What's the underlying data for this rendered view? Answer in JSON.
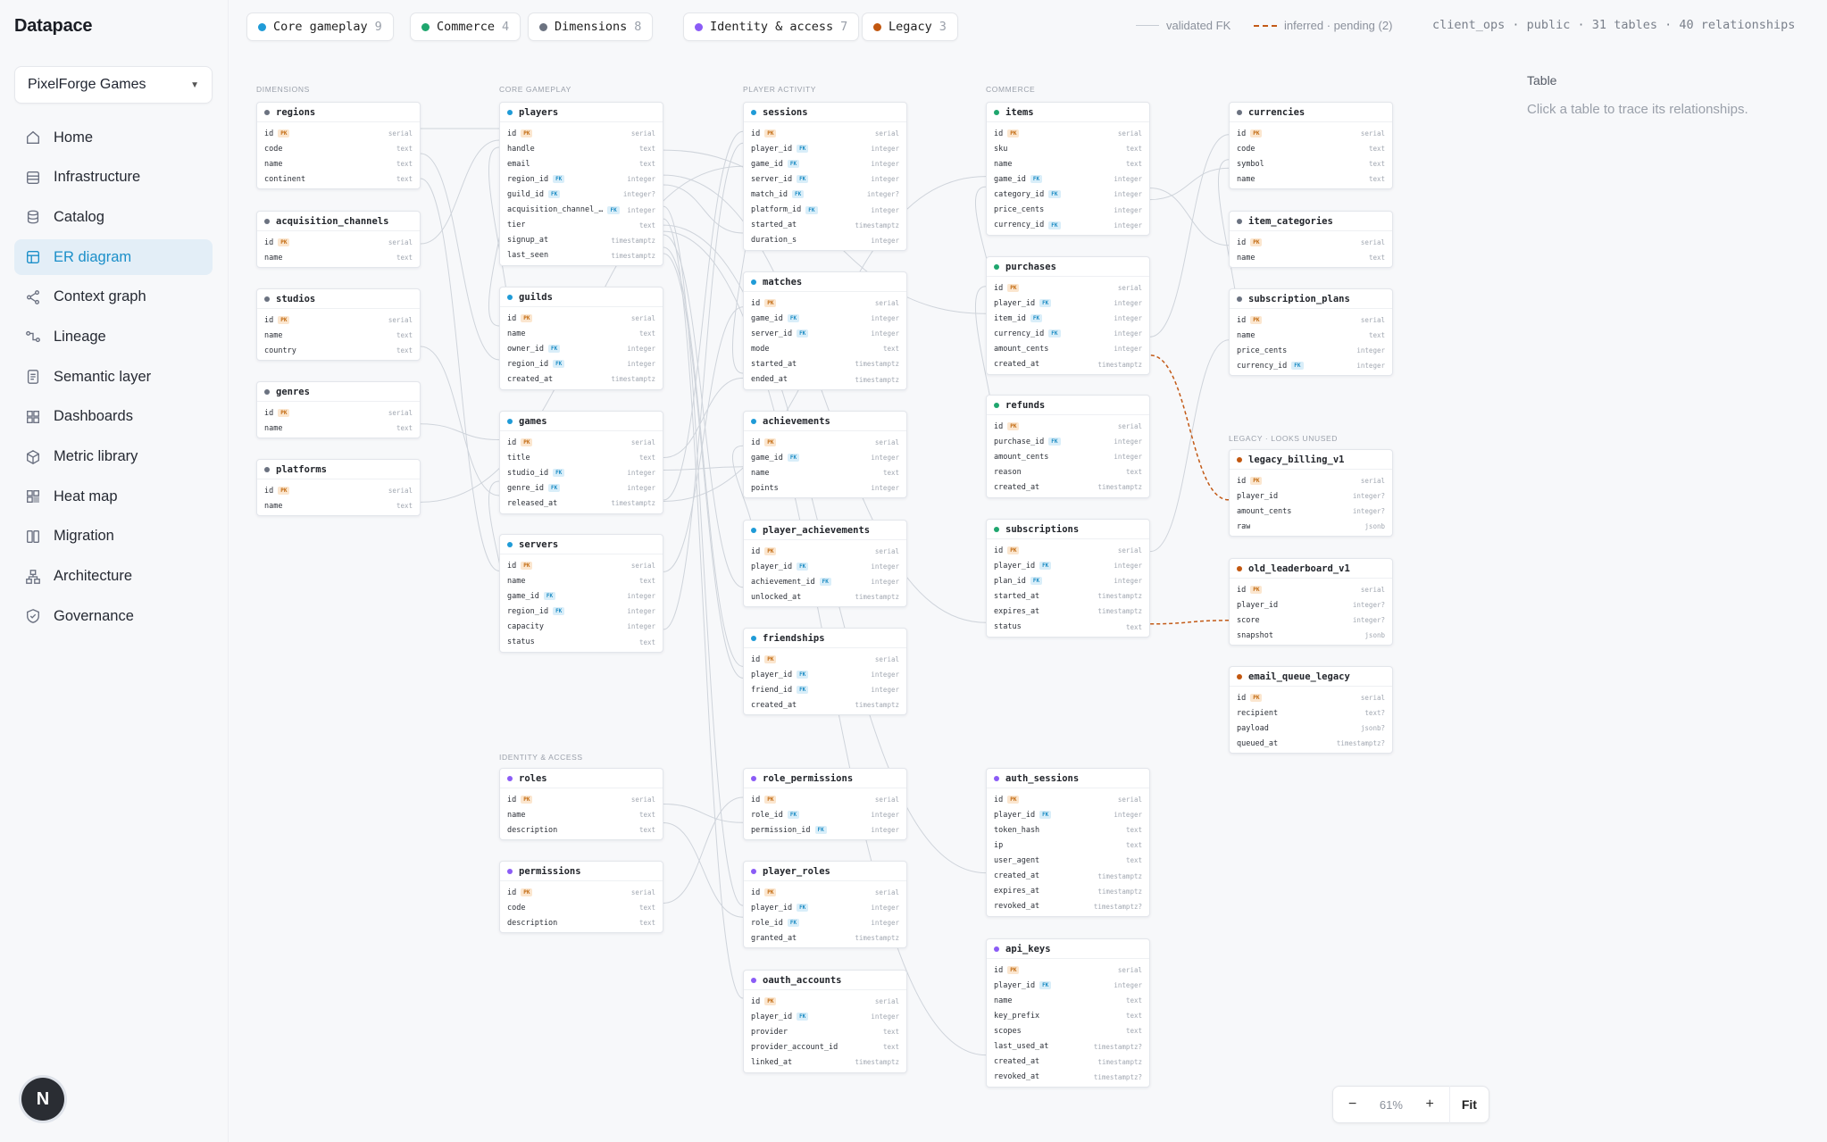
{
  "app": {
    "brand": "Datapace",
    "workspace": "PixelForge Games"
  },
  "sidebar": {
    "items": [
      {
        "label": "Home",
        "icon": "home-icon",
        "active": false
      },
      {
        "label": "Infrastructure",
        "icon": "server-icon",
        "active": false
      },
      {
        "label": "Catalog",
        "icon": "database-icon",
        "active": false
      },
      {
        "label": "ER diagram",
        "icon": "er-diagram-icon",
        "active": true
      },
      {
        "label": "Context graph",
        "icon": "share-graph-icon",
        "active": false
      },
      {
        "label": "Lineage",
        "icon": "lineage-icon",
        "active": false
      },
      {
        "label": "Semantic layer",
        "icon": "document-icon",
        "active": false
      },
      {
        "label": "Dashboards",
        "icon": "grid-icon",
        "active": false
      },
      {
        "label": "Metric library",
        "icon": "cube-icon",
        "active": false
      },
      {
        "label": "Heat map",
        "icon": "heatmap-icon",
        "active": false
      },
      {
        "label": "Migration",
        "icon": "migration-icon",
        "active": false
      },
      {
        "label": "Architecture",
        "icon": "architecture-icon",
        "active": false
      },
      {
        "label": "Governance",
        "icon": "shield-icon",
        "active": false
      }
    ],
    "avatar": "N"
  },
  "filters": [
    {
      "label": "Core gameplay",
      "count": "9",
      "color": "#1f9bd7"
    },
    {
      "label": "Commerce",
      "count": "4",
      "color": "#1fa66e"
    },
    {
      "label": "Dimensions",
      "count": "8",
      "color": "#6b7280"
    },
    {
      "label": "Identity & access",
      "count": "7",
      "color": "#8b5cf6"
    },
    {
      "label": "Legacy",
      "count": "3",
      "color": "#c2570f"
    }
  ],
  "legend": {
    "validated": "validated FK",
    "inferred": "inferred · pending (2)"
  },
  "meta": "client_ops · public · 31 tables · 40 relationships",
  "panel": {
    "title": "Table",
    "hint": "Click a table to trace its relationships."
  },
  "zoom": {
    "minus": "−",
    "level": "61%",
    "plus": "+",
    "fit": "Fit"
  },
  "groups": [
    {
      "label": "Dimensions"
    },
    {
      "label": "Core gameplay"
    },
    {
      "label": "Player activity"
    },
    {
      "label": "Commerce"
    },
    {
      "label": "Identity & access"
    },
    {
      "label": "Legacy · looks unused"
    }
  ],
  "tables": [
    {
      "name": "regions",
      "group": "dim",
      "columns": [
        [
          "id",
          "PK",
          "serial"
        ],
        [
          "code",
          "",
          "text"
        ],
        [
          "name",
          "",
          "text"
        ],
        [
          "continent",
          "",
          "text"
        ]
      ]
    },
    {
      "name": "acquisition_channels",
      "group": "dim",
      "columns": [
        [
          "id",
          "PK",
          "serial"
        ],
        [
          "name",
          "",
          "text"
        ]
      ]
    },
    {
      "name": "studios",
      "group": "dim",
      "columns": [
        [
          "id",
          "PK",
          "serial"
        ],
        [
          "name",
          "",
          "text"
        ],
        [
          "country",
          "",
          "text"
        ]
      ]
    },
    {
      "name": "genres",
      "group": "dim",
      "columns": [
        [
          "id",
          "PK",
          "serial"
        ],
        [
          "name",
          "",
          "text"
        ]
      ]
    },
    {
      "name": "platforms",
      "group": "dim",
      "columns": [
        [
          "id",
          "PK",
          "serial"
        ],
        [
          "name",
          "",
          "text"
        ]
      ]
    },
    {
      "name": "players",
      "group": "core",
      "columns": [
        [
          "id",
          "PK",
          "serial"
        ],
        [
          "handle",
          "",
          "text"
        ],
        [
          "email",
          "",
          "text"
        ],
        [
          "region_id",
          "FK",
          "integer"
        ],
        [
          "guild_id",
          "FK",
          "integer?"
        ],
        [
          "acquisition_channel_…",
          "FK",
          "integer"
        ],
        [
          "tier",
          "",
          "text"
        ],
        [
          "signup_at",
          "",
          "timestamptz"
        ],
        [
          "last_seen",
          "",
          "timestamptz"
        ]
      ]
    },
    {
      "name": "guilds",
      "group": "core",
      "columns": [
        [
          "id",
          "PK",
          "serial"
        ],
        [
          "name",
          "",
          "text"
        ],
        [
          "owner_id",
          "FK",
          "integer"
        ],
        [
          "region_id",
          "FK",
          "integer"
        ],
        [
          "created_at",
          "",
          "timestamptz"
        ]
      ]
    },
    {
      "name": "games",
      "group": "core",
      "columns": [
        [
          "id",
          "PK",
          "serial"
        ],
        [
          "title",
          "",
          "text"
        ],
        [
          "studio_id",
          "FK",
          "integer"
        ],
        [
          "genre_id",
          "FK",
          "integer"
        ],
        [
          "released_at",
          "",
          "timestamptz"
        ]
      ]
    },
    {
      "name": "servers",
      "group": "core",
      "columns": [
        [
          "id",
          "PK",
          "serial"
        ],
        [
          "name",
          "",
          "text"
        ],
        [
          "game_id",
          "FK",
          "integer"
        ],
        [
          "region_id",
          "FK",
          "integer"
        ],
        [
          "capacity",
          "",
          "integer"
        ],
        [
          "status",
          "",
          "text"
        ]
      ]
    },
    {
      "name": "sessions",
      "group": "core",
      "columns": [
        [
          "id",
          "PK",
          "serial"
        ],
        [
          "player_id",
          "FK",
          "integer"
        ],
        [
          "game_id",
          "FK",
          "integer"
        ],
        [
          "server_id",
          "FK",
          "integer"
        ],
        [
          "match_id",
          "FK",
          "integer?"
        ],
        [
          "platform_id",
          "FK",
          "integer"
        ],
        [
          "started_at",
          "",
          "timestamptz"
        ],
        [
          "duration_s",
          "",
          "integer"
        ]
      ]
    },
    {
      "name": "matches",
      "group": "core",
      "columns": [
        [
          "id",
          "PK",
          "serial"
        ],
        [
          "game_id",
          "FK",
          "integer"
        ],
        [
          "server_id",
          "FK",
          "integer"
        ],
        [
          "mode",
          "",
          "text"
        ],
        [
          "started_at",
          "",
          "timestamptz"
        ],
        [
          "ended_at",
          "",
          "timestamptz"
        ]
      ]
    },
    {
      "name": "achievements",
      "group": "core",
      "columns": [
        [
          "id",
          "PK",
          "serial"
        ],
        [
          "game_id",
          "FK",
          "integer"
        ],
        [
          "name",
          "",
          "text"
        ],
        [
          "points",
          "",
          "integer"
        ]
      ]
    },
    {
      "name": "player_achievements",
      "group": "core",
      "columns": [
        [
          "id",
          "PK",
          "serial"
        ],
        [
          "player_id",
          "FK",
          "integer"
        ],
        [
          "achievement_id",
          "FK",
          "integer"
        ],
        [
          "unlocked_at",
          "",
          "timestamptz"
        ]
      ]
    },
    {
      "name": "friendships",
      "group": "core",
      "columns": [
        [
          "id",
          "PK",
          "serial"
        ],
        [
          "player_id",
          "FK",
          "integer"
        ],
        [
          "friend_id",
          "FK",
          "integer"
        ],
        [
          "created_at",
          "",
          "timestamptz"
        ]
      ]
    },
    {
      "name": "items",
      "group": "commerce",
      "columns": [
        [
          "id",
          "PK",
          "serial"
        ],
        [
          "sku",
          "",
          "text"
        ],
        [
          "name",
          "",
          "text"
        ],
        [
          "game_id",
          "FK",
          "integer"
        ],
        [
          "category_id",
          "FK",
          "integer"
        ],
        [
          "price_cents",
          "",
          "integer"
        ],
        [
          "currency_id",
          "FK",
          "integer"
        ]
      ]
    },
    {
      "name": "purchases",
      "group": "commerce",
      "columns": [
        [
          "id",
          "PK",
          "serial"
        ],
        [
          "player_id",
          "FK",
          "integer"
        ],
        [
          "item_id",
          "FK",
          "integer"
        ],
        [
          "currency_id",
          "FK",
          "integer"
        ],
        [
          "amount_cents",
          "",
          "integer"
        ],
        [
          "created_at",
          "",
          "timestamptz"
        ]
      ]
    },
    {
      "name": "refunds",
      "group": "commerce",
      "columns": [
        [
          "id",
          "PK",
          "serial"
        ],
        [
          "purchase_id",
          "FK",
          "integer"
        ],
        [
          "amount_cents",
          "",
          "integer"
        ],
        [
          "reason",
          "",
          "text"
        ],
        [
          "created_at",
          "",
          "timestamptz"
        ]
      ]
    },
    {
      "name": "subscriptions",
      "group": "commerce",
      "columns": [
        [
          "id",
          "PK",
          "serial"
        ],
        [
          "player_id",
          "FK",
          "integer"
        ],
        [
          "plan_id",
          "FK",
          "integer"
        ],
        [
          "started_at",
          "",
          "timestamptz"
        ],
        [
          "expires_at",
          "",
          "timestamptz"
        ],
        [
          "status",
          "",
          "text"
        ]
      ]
    },
    {
      "name": "currencies",
      "group": "dim",
      "columns": [
        [
          "id",
          "PK",
          "serial"
        ],
        [
          "code",
          "",
          "text"
        ],
        [
          "symbol",
          "",
          "text"
        ],
        [
          "name",
          "",
          "text"
        ]
      ]
    },
    {
      "name": "item_categories",
      "group": "dim",
      "columns": [
        [
          "id",
          "PK",
          "serial"
        ],
        [
          "name",
          "",
          "text"
        ]
      ]
    },
    {
      "name": "subscription_plans",
      "group": "dim",
      "columns": [
        [
          "id",
          "PK",
          "serial"
        ],
        [
          "name",
          "",
          "text"
        ],
        [
          "price_cents",
          "",
          "integer"
        ],
        [
          "currency_id",
          "FK",
          "integer"
        ]
      ]
    },
    {
      "name": "legacy_billing_v1",
      "group": "legacy",
      "columns": [
        [
          "id",
          "PK",
          "serial"
        ],
        [
          "player_id",
          "",
          "integer?"
        ],
        [
          "amount_cents",
          "",
          "integer?"
        ],
        [
          "raw",
          "",
          "jsonb"
        ]
      ]
    },
    {
      "name": "old_leaderboard_v1",
      "group": "legacy",
      "columns": [
        [
          "id",
          "PK",
          "serial"
        ],
        [
          "player_id",
          "",
          "integer?"
        ],
        [
          "score",
          "",
          "integer?"
        ],
        [
          "snapshot",
          "",
          "jsonb"
        ]
      ]
    },
    {
      "name": "email_queue_legacy",
      "group": "legacy",
      "columns": [
        [
          "id",
          "PK",
          "serial"
        ],
        [
          "recipient",
          "",
          "text?"
        ],
        [
          "payload",
          "",
          "jsonb?"
        ],
        [
          "queued_at",
          "",
          "timestamptz?"
        ]
      ]
    },
    {
      "name": "roles",
      "group": "identity",
      "columns": [
        [
          "id",
          "PK",
          "serial"
        ],
        [
          "name",
          "",
          "text"
        ],
        [
          "description",
          "",
          "text"
        ]
      ]
    },
    {
      "name": "permissions",
      "group": "identity",
      "columns": [
        [
          "id",
          "PK",
          "serial"
        ],
        [
          "code",
          "",
          "text"
        ],
        [
          "description",
          "",
          "text"
        ]
      ]
    },
    {
      "name": "role_permissions",
      "group": "identity",
      "columns": [
        [
          "id",
          "PK",
          "serial"
        ],
        [
          "role_id",
          "FK",
          "integer"
        ],
        [
          "permission_id",
          "FK",
          "integer"
        ]
      ]
    },
    {
      "name": "player_roles",
      "group": "identity",
      "columns": [
        [
          "id",
          "PK",
          "serial"
        ],
        [
          "player_id",
          "FK",
          "integer"
        ],
        [
          "role_id",
          "FK",
          "integer"
        ],
        [
          "granted_at",
          "",
          "timestamptz"
        ]
      ]
    },
    {
      "name": "oauth_accounts",
      "group": "identity",
      "columns": [
        [
          "id",
          "PK",
          "serial"
        ],
        [
          "player_id",
          "FK",
          "integer"
        ],
        [
          "provider",
          "",
          "text"
        ],
        [
          "provider_account_id",
          "",
          "text"
        ],
        [
          "linked_at",
          "",
          "timestamptz"
        ]
      ]
    },
    {
      "name": "auth_sessions",
      "group": "identity",
      "columns": [
        [
          "id",
          "PK",
          "serial"
        ],
        [
          "player_id",
          "FK",
          "integer"
        ],
        [
          "token_hash",
          "",
          "text"
        ],
        [
          "ip",
          "",
          "text"
        ],
        [
          "user_agent",
          "",
          "text"
        ],
        [
          "created_at",
          "",
          "timestamptz"
        ],
        [
          "expires_at",
          "",
          "timestamptz"
        ],
        [
          "revoked_at",
          "",
          "timestamptz?"
        ]
      ]
    },
    {
      "name": "api_keys",
      "group": "identity",
      "columns": [
        [
          "id",
          "PK",
          "serial"
        ],
        [
          "player_id",
          "FK",
          "integer"
        ],
        [
          "name",
          "",
          "text"
        ],
        [
          "key_prefix",
          "",
          "text"
        ],
        [
          "scopes",
          "",
          "text"
        ],
        [
          "last_used_at",
          "",
          "timestamptz?"
        ],
        [
          "created_at",
          "",
          "timestamptz"
        ],
        [
          "revoked_at",
          "",
          "timestamptz?"
        ]
      ]
    }
  ],
  "group_colors": {
    "dim": "#6b7280",
    "core": "#1f9bd7",
    "commerce": "#1fa66e",
    "identity": "#8b5cf6",
    "legacy": "#c2570f"
  },
  "relationships": [
    [
      "players",
      "regions",
      false
    ],
    [
      "players",
      "acquisition_channels",
      false
    ],
    [
      "players",
      "guilds",
      false
    ],
    [
      "guilds",
      "players",
      false
    ],
    [
      "guilds",
      "regions",
      false
    ],
    [
      "games",
      "studios",
      false
    ],
    [
      "games",
      "genres",
      false
    ],
    [
      "servers",
      "games",
      false
    ],
    [
      "servers",
      "regions",
      false
    ],
    [
      "sessions",
      "players",
      false
    ],
    [
      "sessions",
      "games",
      false
    ],
    [
      "sessions",
      "servers",
      false
    ],
    [
      "sessions",
      "matches",
      false
    ],
    [
      "sessions",
      "platforms",
      false
    ],
    [
      "matches",
      "games",
      false
    ],
    [
      "matches",
      "servers",
      false
    ],
    [
      "achievements",
      "games",
      false
    ],
    [
      "player_achievements",
      "players",
      false
    ],
    [
      "player_achievements",
      "achievements",
      false
    ],
    [
      "friendships",
      "players",
      false
    ],
    [
      "friendships",
      "players",
      false
    ],
    [
      "items",
      "games",
      false
    ],
    [
      "items",
      "item_categories",
      false
    ],
    [
      "items",
      "currencies",
      false
    ],
    [
      "purchases",
      "players",
      false
    ],
    [
      "purchases",
      "items",
      false
    ],
    [
      "purchases",
      "currencies",
      false
    ],
    [
      "refunds",
      "purchases",
      false
    ],
    [
      "subscriptions",
      "players",
      false
    ],
    [
      "subscriptions",
      "subscription_plans",
      false
    ],
    [
      "subscription_plans",
      "currencies",
      false
    ],
    [
      "role_permissions",
      "roles",
      false
    ],
    [
      "role_permissions",
      "permissions",
      false
    ],
    [
      "player_roles",
      "players",
      false
    ],
    [
      "player_roles",
      "roles",
      false
    ],
    [
      "oauth_accounts",
      "players",
      false
    ],
    [
      "auth_sessions",
      "players",
      false
    ],
    [
      "api_keys",
      "players",
      false
    ],
    [
      "legacy_billing_v1",
      "purchases",
      true
    ],
    [
      "old_leaderboard_v1",
      "subscriptions",
      true
    ]
  ]
}
